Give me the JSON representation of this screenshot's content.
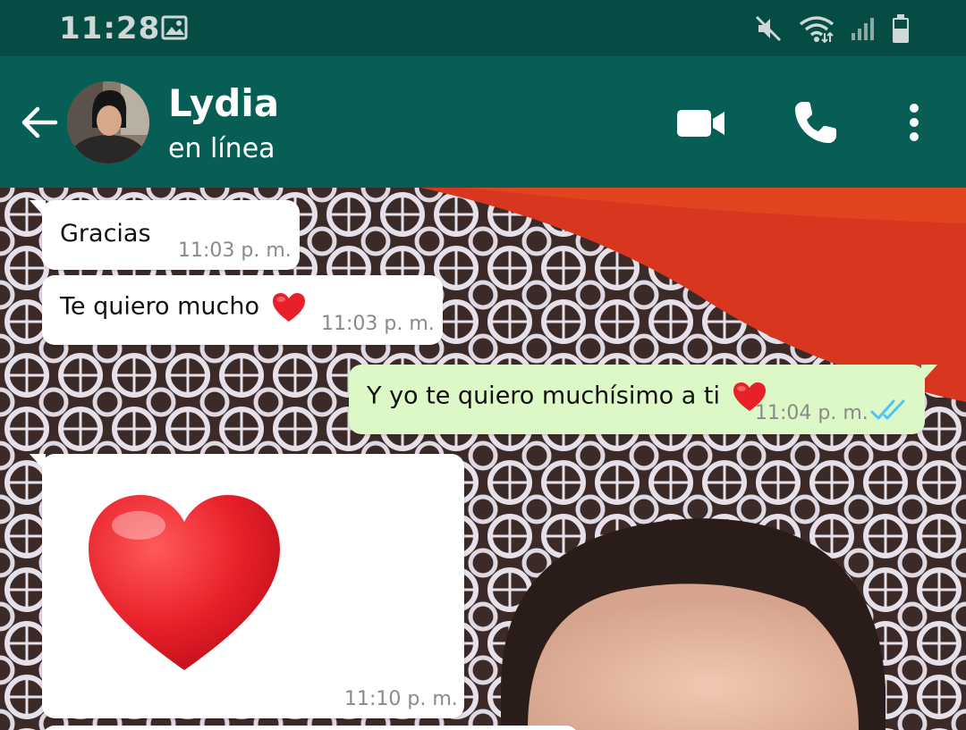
{
  "status_bar": {
    "time": "11:28",
    "icons": [
      "image-icon",
      "mute-icon",
      "wifi-icon",
      "signal-icon",
      "battery-icon"
    ]
  },
  "header": {
    "contact_name": "Lydia",
    "contact_status": "en línea",
    "icons": [
      "back-arrow-icon",
      "video-call-icon",
      "phone-icon",
      "more-options-icon"
    ],
    "color": "#075e54"
  },
  "messages": [
    {
      "direction": "in",
      "text": "Gracias",
      "time": "11:03 p. m."
    },
    {
      "direction": "in",
      "text": "Te quiero mucho",
      "emoji": "heart",
      "time": "11:03 p. m."
    },
    {
      "direction": "out",
      "text": "Y yo te quiero muchísimo a ti",
      "emoji": "heart",
      "time": "11:04 p. m.",
      "read": true
    },
    {
      "direction": "in",
      "emoji": "heart",
      "big_emoji": true,
      "time": "11:10 p. m."
    }
  ],
  "colors": {
    "status_bar": "#054d44",
    "outgoing_bubble": "#dcf8c6",
    "incoming_bubble": "#ffffff",
    "read_ticks": "#4fc3f7",
    "heart": "#e8202a"
  }
}
